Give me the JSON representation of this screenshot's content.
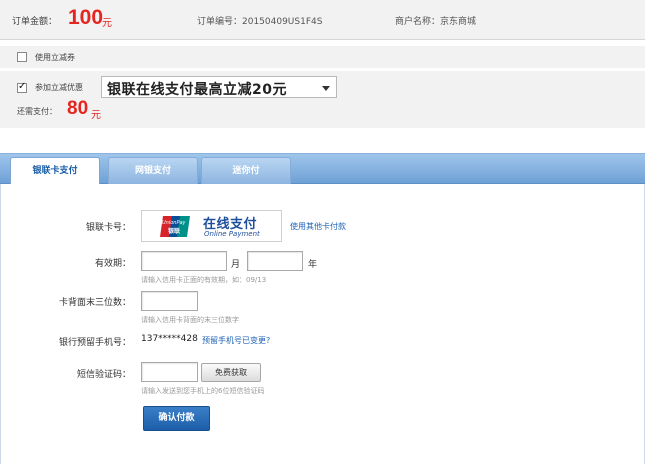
{
  "order": {
    "amount_label": "订单金额：",
    "amount": "100",
    "amount_unit": "元",
    "order_no": "订单编号：20150409US1F4S",
    "merchant": "商户名称：京东商城"
  },
  "coupon": {
    "use_coupon_label": "使用立减券",
    "use_coupon_checked": false,
    "join_discount_label": "参加立减优惠",
    "join_discount_checked": true,
    "discount_option": "银联在线支付最高立减20元",
    "still_pay_label": "还需支付：",
    "still_pay_amount": "80",
    "still_pay_unit": "元"
  },
  "tabs": [
    {
      "label": "银联卡支付",
      "active": true
    },
    {
      "label": "网银支付",
      "active": false
    },
    {
      "label": "迷你付",
      "active": false
    }
  ],
  "form": {
    "card_label": "银联卡号：",
    "unionpay_cn": "在线支付",
    "unionpay_en": "Online Payment",
    "unionpay_logo_text": "UnionPay",
    "unionpay_logo_cn": "银联",
    "other_card_link": "使用其他卡付款",
    "expiry_label": "有效期：",
    "month_unit": "月",
    "year_unit": "年",
    "expiry_hint": "请输入信用卡正面的有效期，如：09/13",
    "cvv_label": "卡背面末三位数：",
    "cvv_hint": "请输入信用卡背面的末三位数字",
    "phone_label": "银行预留手机号：",
    "phone_value": "137*****428",
    "phone_changed_link": "预留手机号已变更?",
    "sms_label": "短信验证码：",
    "sms_button": "免费获取",
    "sms_hint": "请输入发送到您手机上的6位短信验证码",
    "confirm_button": "确认付款"
  },
  "colors": {
    "accent_red": "#e5251f",
    "link_blue": "#1e63b8",
    "tab_blue": "#6fa1d6"
  }
}
